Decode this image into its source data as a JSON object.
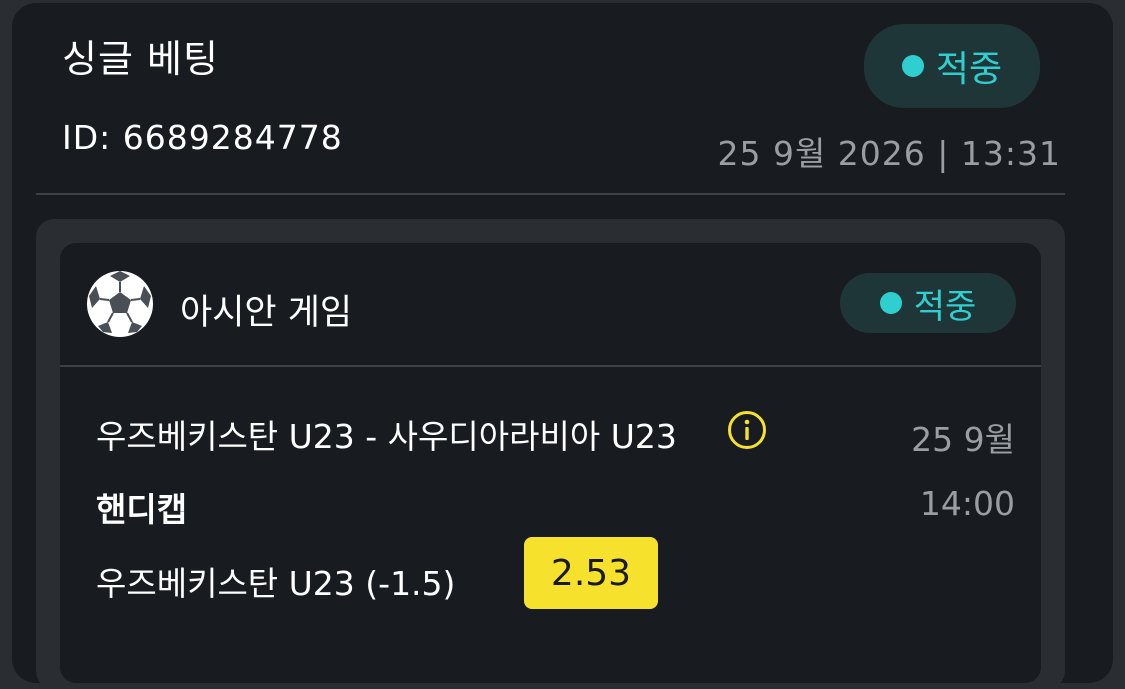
{
  "bet": {
    "title": "싱글 베팅",
    "status": "적중",
    "id_label": "ID: 6689284778",
    "datetime": "25 9월 2026 | 13:31"
  },
  "game": {
    "category": "아시안 게임",
    "category_icon": "soccer-ball-icon",
    "status": "적중",
    "match": "우즈베키스탄 U23 - 사우디아라비아 U23",
    "date": "25 9월",
    "time": "14:00",
    "market": "핸디캡",
    "selection": "우즈베키스탄 U23 (-1.5)",
    "odds": "2.53"
  },
  "colors": {
    "background": "#181c21",
    "status_accent": "#30cfcf",
    "odds_badge": "#f6e22c",
    "info_icon": "#f6e22c"
  }
}
